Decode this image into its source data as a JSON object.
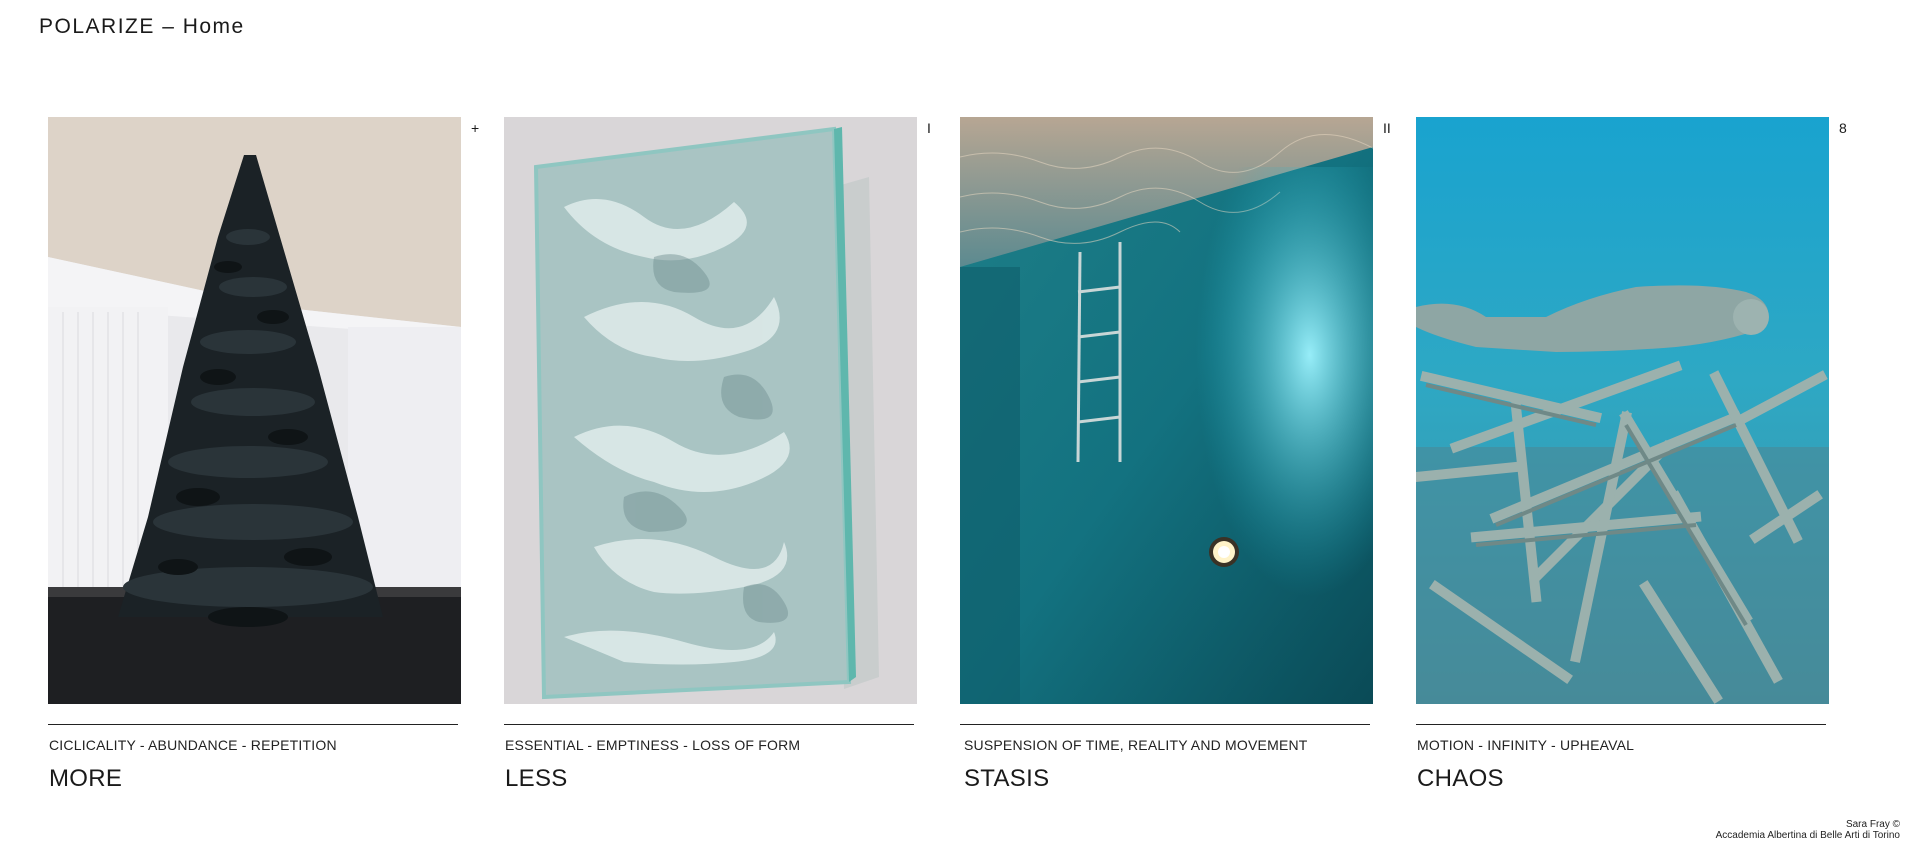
{
  "header": {
    "title": "POLARIZE – Home"
  },
  "cards": [
    {
      "marker": "+",
      "keywords": "CICLICALITY - ABUNDANCE - REPETITION",
      "title": "MORE"
    },
    {
      "marker": "I",
      "keywords": "ESSENTIAL - EMPTINESS - LOSS OF FORM",
      "title": "LESS"
    },
    {
      "marker": "II",
      "keywords": "SUSPENSION OF TIME, REALITY AND MOVEMENT",
      "title": "STASIS"
    },
    {
      "marker": "8",
      "keywords": "MOTION - INFINITY - UPHEAVAL",
      "title": "CHAOS"
    }
  ],
  "footer": {
    "author": "Sara Fray ©",
    "institution": "Accademia Albertina di Belle Arti di Torino"
  },
  "colors": {
    "text": "#1a1a1a",
    "background": "#ffffff"
  }
}
